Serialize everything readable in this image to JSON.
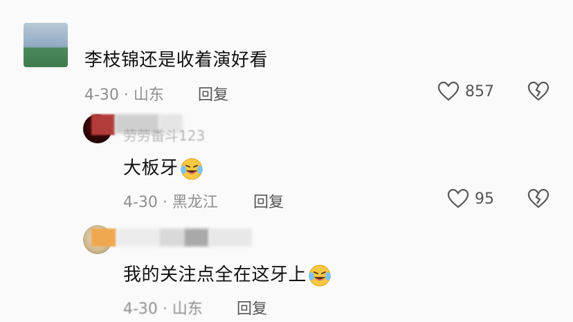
{
  "comments": [
    {
      "text": "李枝锦还是收着演好看",
      "date_location": "4-30 · 山东",
      "reply_label": "回复",
      "likes": "857",
      "avatar_icon": "avatar-image"
    },
    {
      "username": "劳劳畨斗123",
      "text": "大板牙",
      "date_location": "4-30 · 黑龙江",
      "reply_label": "回复",
      "likes": "95",
      "avatar_icon": "avatar-image"
    },
    {
      "username": "",
      "text": "我的关注点全在这牙上",
      "date_location": "4-30 · 山东",
      "reply_label": "回复",
      "avatar_icon": "avatar-image"
    }
  ],
  "icons": {
    "like": "heart-outline-icon",
    "dislike": "broken-heart-icon",
    "emoji": "laughing-crying-emoji"
  },
  "colors": {
    "background": "#fafafa",
    "text": "#111111",
    "meta": "#8e8e8e",
    "reply": "#555555"
  }
}
